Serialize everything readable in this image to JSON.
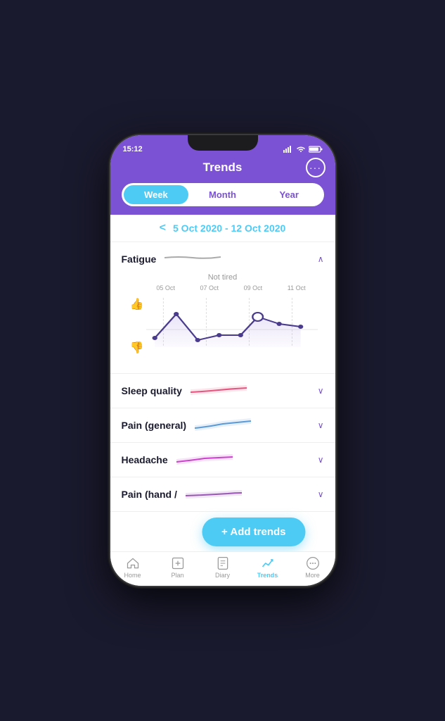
{
  "statusBar": {
    "time": "15:12"
  },
  "header": {
    "title": "Trends",
    "moreLabel": "···"
  },
  "tabs": [
    {
      "label": "Week",
      "active": true
    },
    {
      "label": "Month",
      "active": false
    },
    {
      "label": "Year",
      "active": false
    }
  ],
  "dateRange": {
    "text": "5 Oct 2020 - 12 Oct 2020",
    "backArrow": "<"
  },
  "metrics": [
    {
      "name": "Fatigue",
      "expanded": true,
      "expandIcon": "∧",
      "chartLabel": "Not tired",
      "xLabels": [
        "05 Oct",
        "07 Oct",
        "09 Oct",
        "11 Oct"
      ]
    },
    {
      "name": "Sleep quality",
      "expanded": false,
      "expandIcon": "∨"
    },
    {
      "name": "Pain (general)",
      "expanded": false,
      "expandIcon": "∨"
    },
    {
      "name": "Headache",
      "expanded": false,
      "expandIcon": "∨"
    },
    {
      "name": "Pain (hand /",
      "expanded": false,
      "expandIcon": "∨"
    }
  ],
  "addTrendsBtn": {
    "label": "+ Add trends"
  },
  "bottomNav": [
    {
      "label": "Home",
      "icon": "🏠",
      "active": false
    },
    {
      "label": "Plan",
      "icon": "📋",
      "active": false
    },
    {
      "label": "Diary",
      "icon": "📓",
      "active": false
    },
    {
      "label": "Trends",
      "icon": "📈",
      "active": true
    },
    {
      "label": "More",
      "icon": "💬",
      "active": false
    }
  ]
}
